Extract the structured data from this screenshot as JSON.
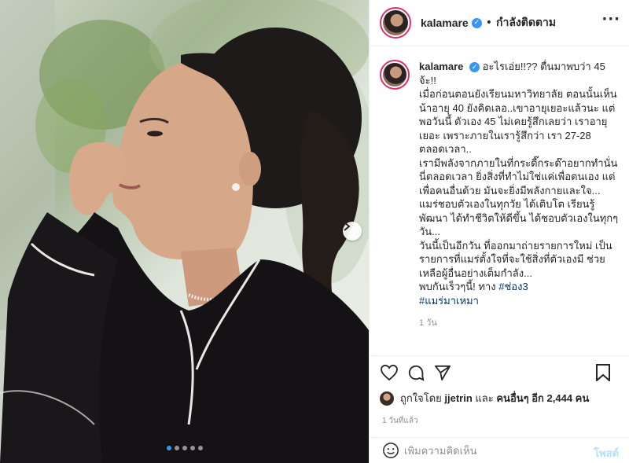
{
  "post": {
    "username": "kalamare",
    "header_separator": "•",
    "follow_status": "กำลังติดตาม",
    "more_icon": "more-options-icon",
    "caption": {
      "username": "kalamare",
      "text_main": "อะไรเอ่ย!!?? ตื่นมาพบว่า 45 จ้ะ!!\nเมื่อก่อนตอนยังเรียนมหาวิทยาลัย ตอนนั้นเห็นน้าอายุ 40 ยังคิดเลอ..เขาอายุเยอะแล้วนะ แต่พอวันนี้ ตัวเอง 45 ไม่เคยรู้สึกเลยว่า เราอายุเยอะ เพราะภายในเรารู้สึกว่า เรา 27-28 ตลอดเวลา..\nเรามีพลังจากภายในที่กระดี๊กระด๊าอยากทำนั่นนี่ตลอดเวลา ยิ่งสิ่งที่ทำไม่ใช่แค่เพื่อตนเอง แต่เพื่อคนอื่นด้วย มันจะยิ่งมีพลังกายและใจ...\nแมร่ชอบตัวเองในทุกวัย ได้เติบโต เรียนรู้ พัฒนา ได้ทำชีวิตให้ดีขึ้น ได้ชอบตัวเองในทุกๆวัน...\nวันนี้เป็นอีกวัน ที่ออกมาถ่ายรายการใหม่ เป็นรายการที่แมร่ตั้งใจที่จะใช้สิ่งที่ตัวเองมี ช่วยเหลือผู้อื่นอย่างเต็มกำลัง...\nพบกันเร็วๆนี้! ทาง ",
      "hashtag_1": "#ช่อง3",
      "hashtag_2": "#แมร่มาเหมา",
      "time": "1 วัน"
    },
    "likes": {
      "prefix": "ถูกใจโดย",
      "user": "jjetrin",
      "connector": "และ",
      "others": "คนอื่นๆ อีก 2,444 คน"
    },
    "post_time": "1 วันที่แล้ว",
    "comment": {
      "placeholder": "เพิ่มความคิดเห็น",
      "post_label": "โพสต์"
    },
    "carousel": {
      "total": 5,
      "active_index": 0
    },
    "colors": {
      "link": "#003569",
      "verified": "#3897f0",
      "muted": "#8e8e8e",
      "post_disabled": "#b2dffc",
      "story_ring": "#e1306c"
    }
  }
}
